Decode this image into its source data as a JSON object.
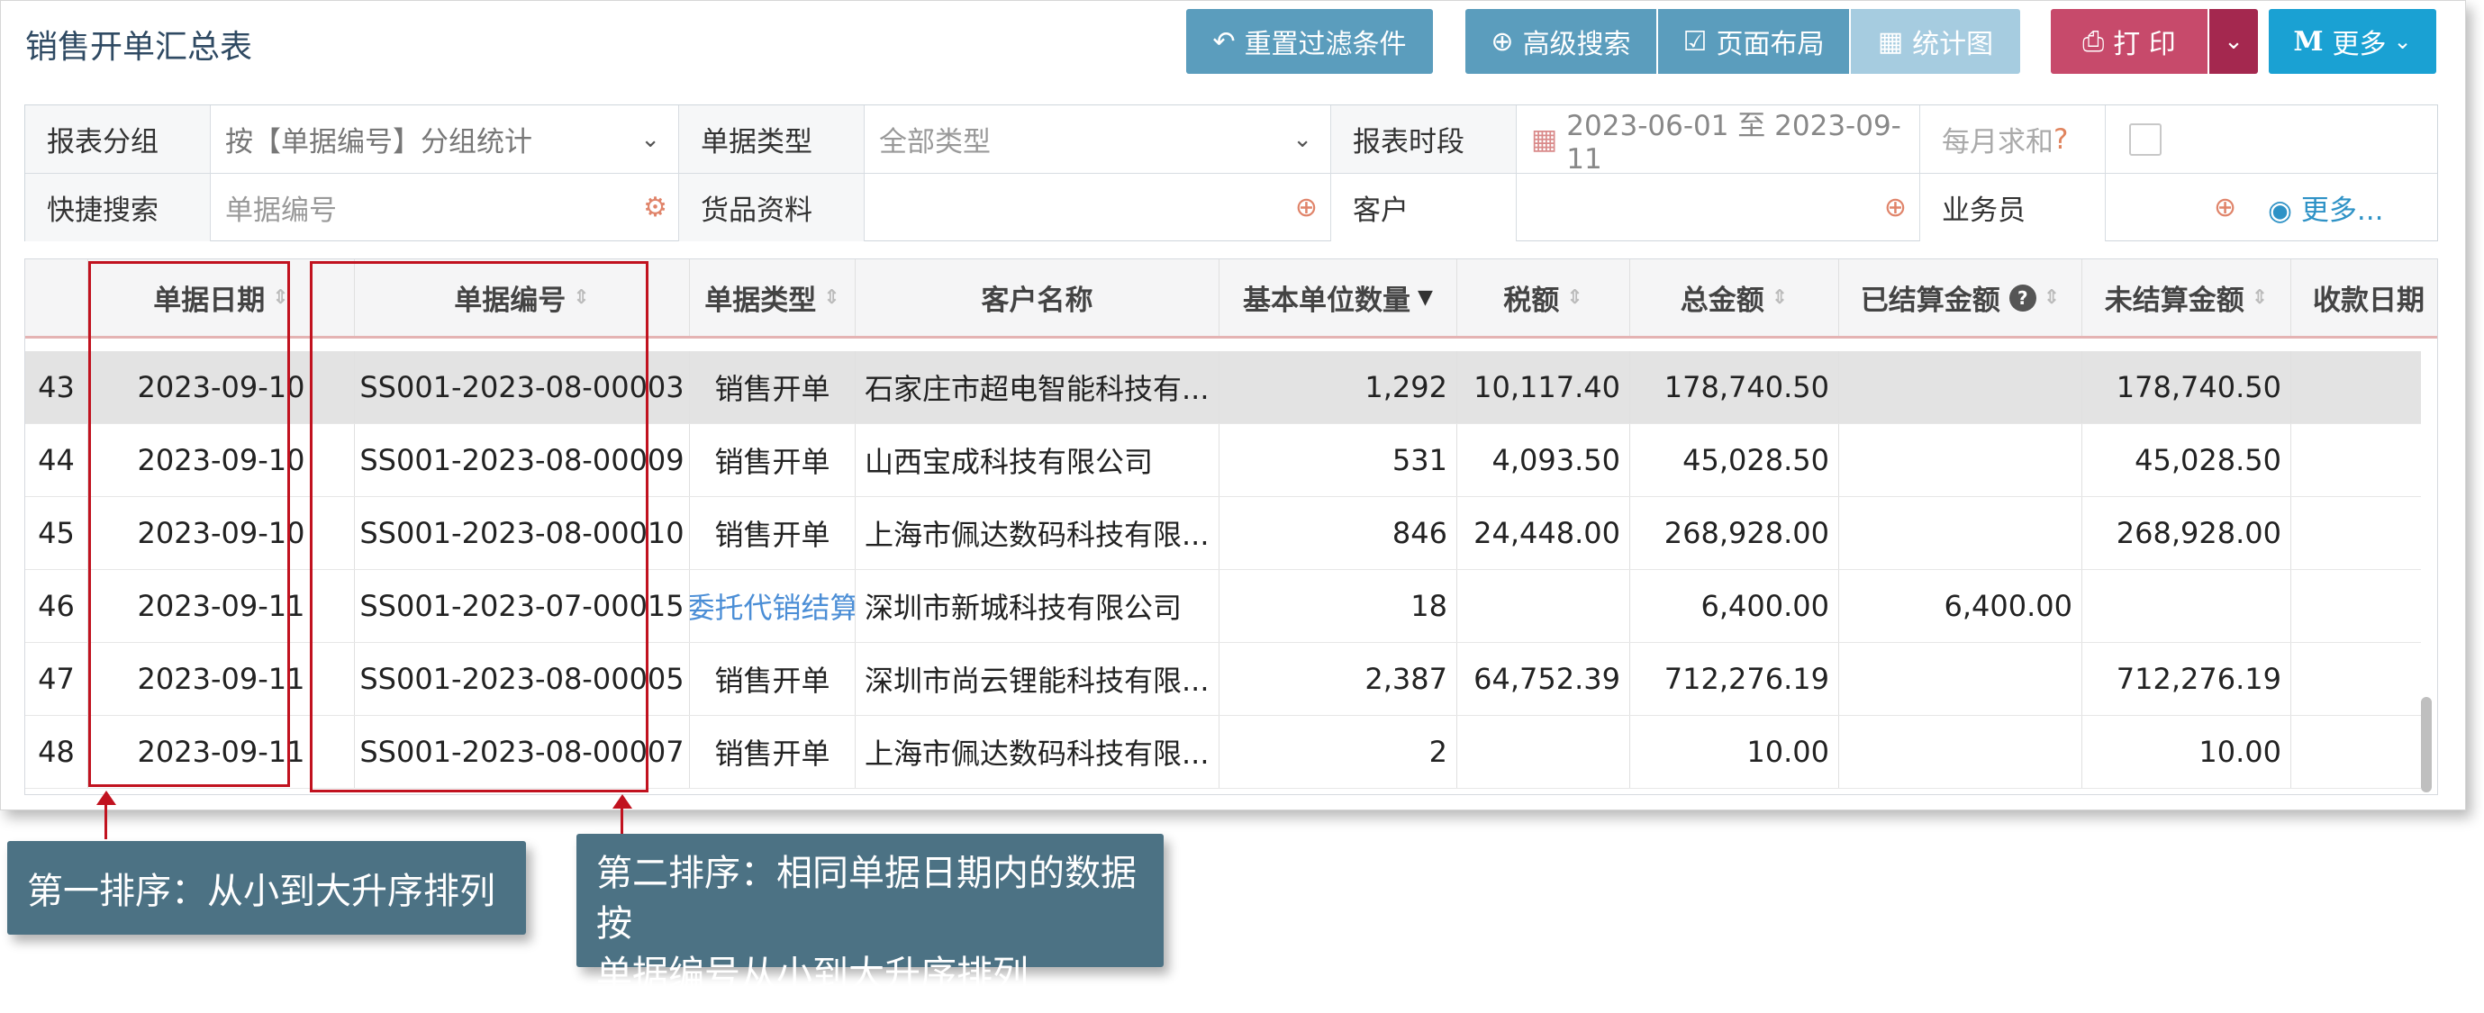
{
  "title": "销售开单汇总表",
  "toolbar": {
    "reset_filter": "重置过滤条件",
    "advanced_search": "高级搜索",
    "page_layout": "页面布局",
    "chart": "统计图",
    "print": "打 印",
    "more": "更多"
  },
  "filters": {
    "report_group_label": "报表分组",
    "report_group_value": "按【单据编号】分组统计",
    "doc_type_label": "单据类型",
    "doc_type_value": "全部类型",
    "period_label": "报表时段",
    "period_value": "2023-06-01 至 2023-09-11",
    "monthly_sum_label": "每月求和",
    "monthly_sum_q": "?",
    "quick_search_label": "快捷搜索",
    "quick_search_placeholder": "单据编号",
    "goods_label": "货品资料",
    "customer_label": "客户",
    "salesman_label": "业务员",
    "more_link": "更多..."
  },
  "table": {
    "headers": [
      "单据日期",
      "单据编号",
      "单据类型",
      "客户名称",
      "基本单位数量",
      "税额",
      "总金额",
      "已结算金额",
      "未结算金额",
      "收款日期"
    ],
    "rows": [
      {
        "no": "43",
        "date": "2023-09-10",
        "doc_no": "SS001-2023-08-00003",
        "type": "销售开单",
        "customer": "石家庄市超电智能科技有...",
        "qty": "1,292",
        "tax": "10,117.40",
        "total": "178,740.50",
        "settled": "",
        "unsettled": "178,740.50",
        "pay_date": ""
      },
      {
        "no": "44",
        "date": "2023-09-10",
        "doc_no": "SS001-2023-08-00009",
        "type": "销售开单",
        "customer": "山西宝成科技有限公司",
        "qty": "531",
        "tax": "4,093.50",
        "total": "45,028.50",
        "settled": "",
        "unsettled": "45,028.50",
        "pay_date": ""
      },
      {
        "no": "45",
        "date": "2023-09-10",
        "doc_no": "SS001-2023-08-00010",
        "type": "销售开单",
        "customer": "上海市佩达数码科技有限...",
        "qty": "846",
        "tax": "24,448.00",
        "total": "268,928.00",
        "settled": "",
        "unsettled": "268,928.00",
        "pay_date": ""
      },
      {
        "no": "46",
        "date": "2023-09-11",
        "doc_no": "SS001-2023-07-00015",
        "type": "委托代销结算",
        "customer": "深圳市新城科技有限公司",
        "qty": "18",
        "tax": "",
        "total": "6,400.00",
        "settled": "6,400.00",
        "unsettled": "",
        "pay_date": ""
      },
      {
        "no": "47",
        "date": "2023-09-11",
        "doc_no": "SS001-2023-08-00005",
        "type": "销售开单",
        "customer": "深圳市尚云锂能科技有限...",
        "qty": "2,387",
        "tax": "64,752.39",
        "total": "712,276.19",
        "settled": "",
        "unsettled": "712,276.19",
        "pay_date": ""
      },
      {
        "no": "48",
        "date": "2023-09-11",
        "doc_no": "SS001-2023-08-00007",
        "type": "销售开单",
        "customer": "上海市佩达数码科技有限...",
        "qty": "2",
        "tax": "",
        "total": "10.00",
        "settled": "",
        "unsettled": "10.00",
        "pay_date": ""
      }
    ]
  },
  "callouts": {
    "first": "第一排序：从小到大升序排列",
    "second_line1": "第二排序：相同单据日期内的数据按",
    "second_line2": "单据编号从小到大升序排列"
  },
  "colors": {
    "accent_teal": "#5b9dbd",
    "print_crimson": "#c74a6b",
    "more_cyan": "#1aa1d3",
    "annotation_red": "#c1121f",
    "callout_bg": "#4c7284"
  }
}
